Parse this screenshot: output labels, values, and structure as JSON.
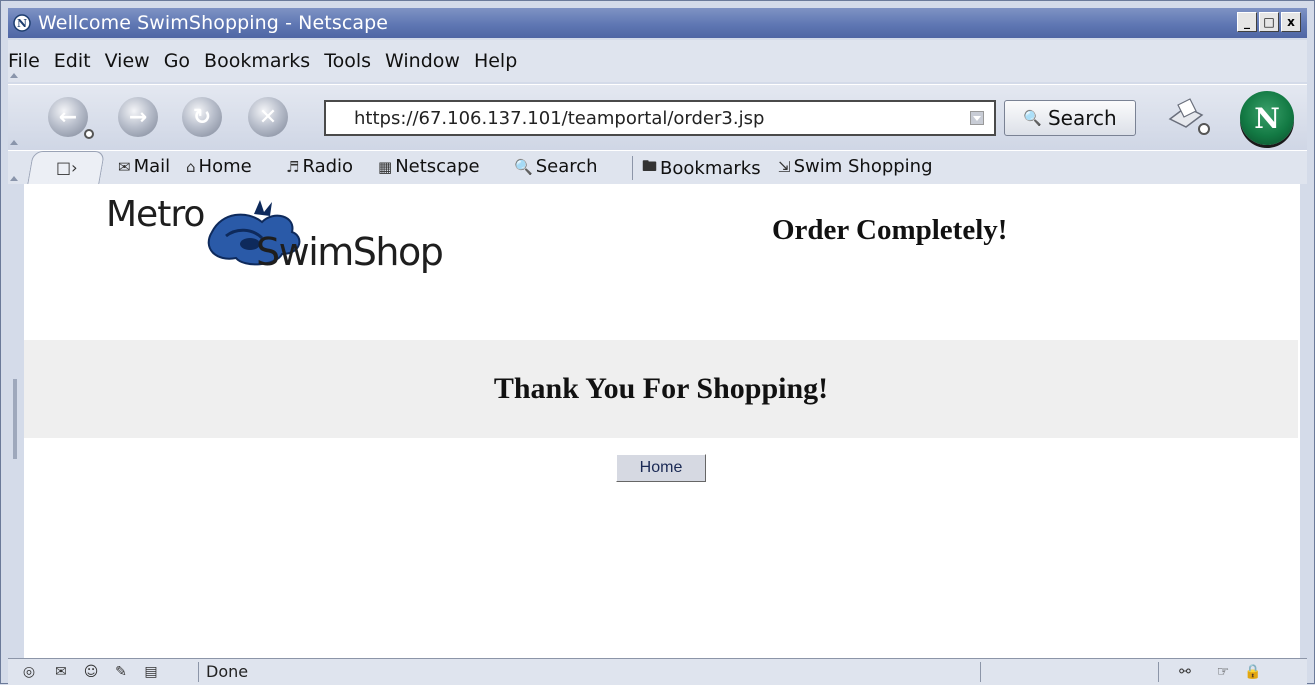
{
  "window": {
    "title": "Wellcome SwimShopping - Netscape",
    "controls": [
      "_",
      "□",
      "x"
    ]
  },
  "menu": [
    "File",
    "Edit",
    "View",
    "Go",
    "Bookmarks",
    "Tools",
    "Window",
    "Help"
  ],
  "nav": {
    "url": "https://67.106.137.101/teamportal/order3.jsp",
    "search_label": "Search"
  },
  "personal_toolbar": {
    "items": [
      "Mail",
      "Home",
      "Radio",
      "Netscape",
      "Search",
      "Bookmarks",
      "Swim Shopping"
    ]
  },
  "page": {
    "logo_top": "Metro",
    "logo_bottom": "SwimShop",
    "order_heading": "Order Completely!",
    "thank_you": "Thank You For Shopping!",
    "home_button": "Home"
  },
  "status": {
    "text": "Done"
  },
  "colors": {
    "titlebar": "#5f77b3",
    "chrome": "#dfe4ee",
    "band": "#efefef",
    "logo_splash": "#2a5aa8"
  }
}
